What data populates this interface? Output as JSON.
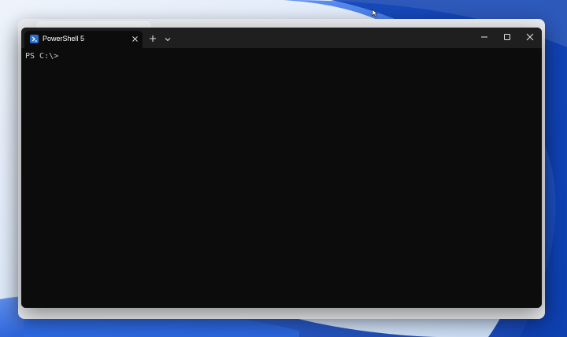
{
  "terminal": {
    "tab_title": "PowerShell 5",
    "prompt": "PS C:\\>"
  },
  "icons": {
    "tab": "powershell-icon",
    "tab_close": "close-icon",
    "new_tab": "plus-icon",
    "dropdown": "chevron-down-icon",
    "minimize": "minimize-icon",
    "maximize": "maximize-icon",
    "close": "close-icon",
    "cursor": "mouse-pointer-icon"
  },
  "colors": {
    "terminal_background": "#0c0c0c",
    "titlebar_background": "#1f1f1f",
    "text": "#cccccc",
    "accent": "#2a6fc9"
  }
}
